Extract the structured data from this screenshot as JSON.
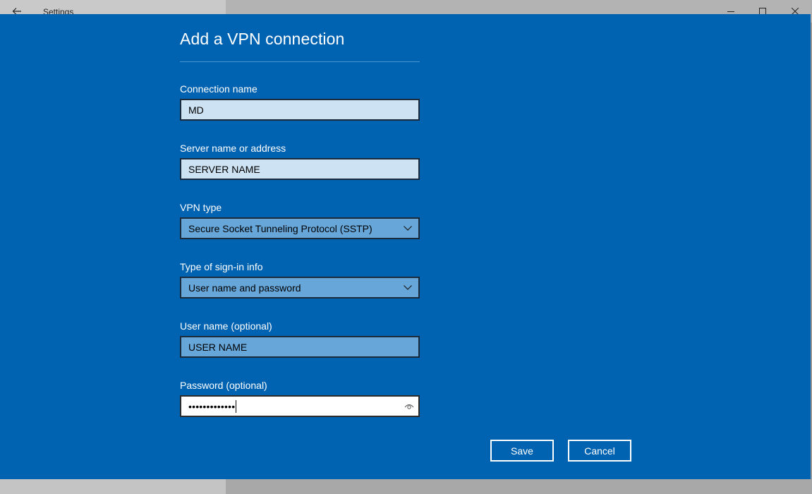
{
  "window": {
    "app_title": "Settings",
    "back_icon": "back-arrow-icon",
    "controls": [
      "minimize-icon",
      "maximize-icon",
      "close-icon"
    ]
  },
  "dialog": {
    "title": "Add a VPN connection",
    "fields": {
      "connection_name": {
        "label": "Connection name",
        "value": "MD"
      },
      "server": {
        "label": "Server name or address",
        "value": "SERVER NAME"
      },
      "vpn_type": {
        "label": "VPN type",
        "value": "Secure Socket Tunneling Protocol (SSTP)"
      },
      "signin_type": {
        "label": "Type of sign-in info",
        "value": "User name and password"
      },
      "username": {
        "label": "User name (optional)",
        "value": "USER NAME"
      },
      "password": {
        "label": "Password (optional)",
        "value": "•••••••••••••"
      }
    },
    "buttons": {
      "save": "Save",
      "cancel": "Cancel"
    }
  },
  "colors": {
    "dialog_bg": "#0063b1",
    "field_light": "#cde2f2",
    "field_mid": "#66a6d9",
    "text_on_dialog": "#ffffff"
  }
}
